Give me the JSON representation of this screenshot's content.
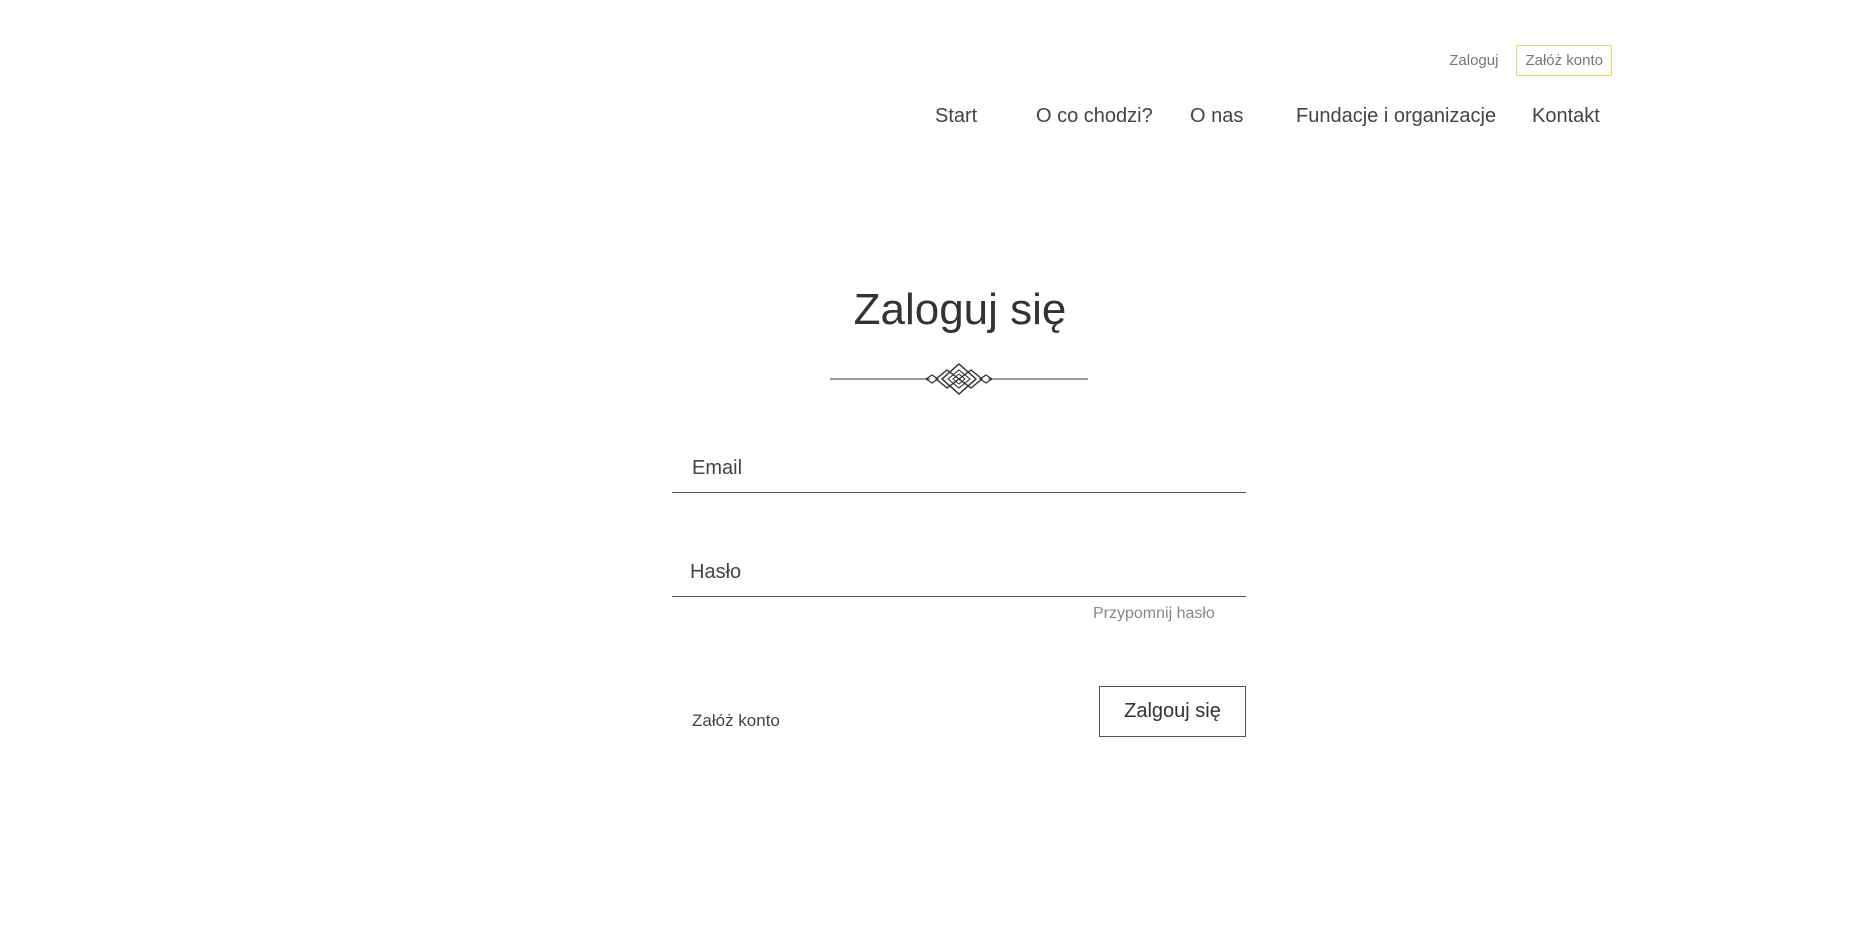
{
  "header": {
    "login_label": "Zaloguj",
    "register_label": "Załóż konto",
    "nav": {
      "start": "Start",
      "about_idea": "O co chodzi?",
      "about_us": "O nas",
      "foundations": "Fundacje i organizacje",
      "contact": "Kontakt"
    }
  },
  "login_form": {
    "title": "Zaloguj się",
    "email_placeholder": "Email",
    "password_placeholder": "Hasło",
    "forgot_password": "Przypomnij hasło",
    "register_link": "Załóż konto",
    "submit_label": "Zalgouj się"
  },
  "colors": {
    "accent_border": "#e8d46a",
    "text": "#333333",
    "muted_text": "#888888"
  },
  "icons": {
    "divider": "ornament-divider-icon"
  }
}
